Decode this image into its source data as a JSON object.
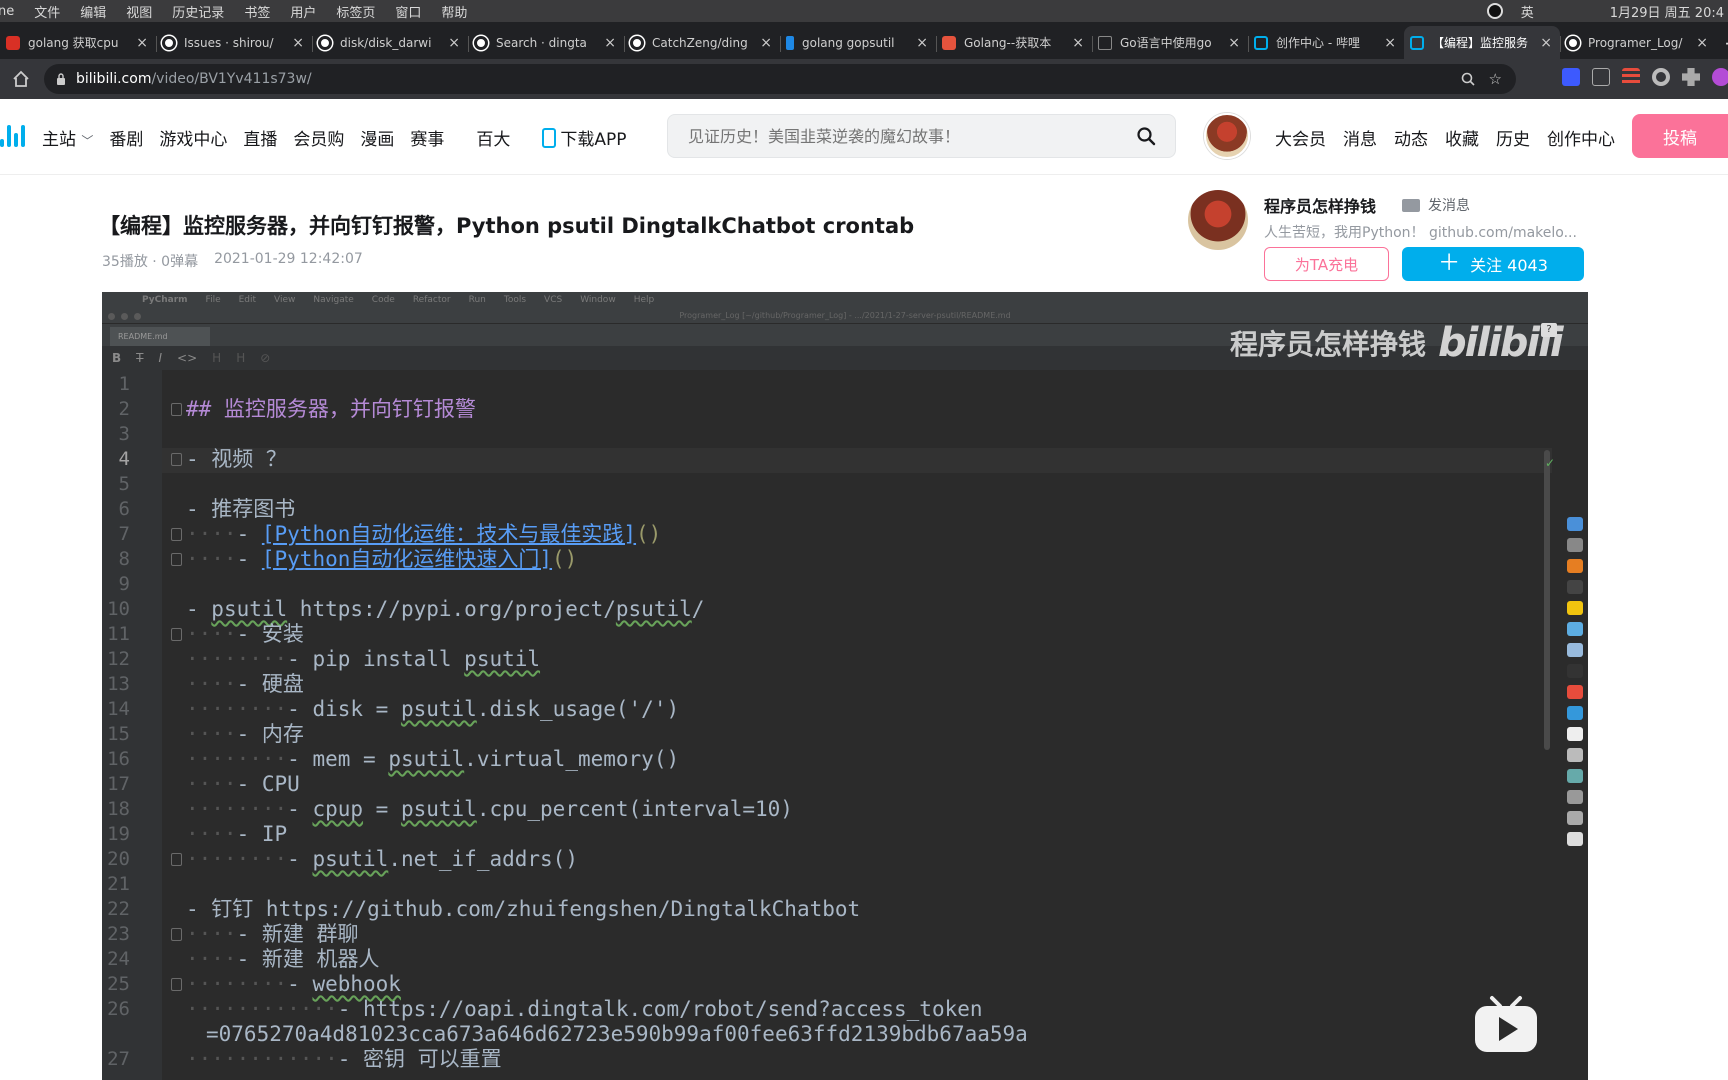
{
  "mac_menubar": {
    "items": [
      "ne",
      "文件",
      "编辑",
      "视图",
      "历史记录",
      "书签",
      "用户",
      "标签页",
      "窗口",
      "帮助"
    ],
    "input_method": "英",
    "datetime": "1月29日 周五  20:4"
  },
  "tabs": [
    {
      "label": "golang 获取cpu",
      "icon": "red-c-icon",
      "color": "#d93025"
    },
    {
      "label": "Issues · shirou/",
      "icon": "github-icon",
      "color": "#ffffff"
    },
    {
      "label": "disk/disk_darwi",
      "icon": "github-icon",
      "color": "#ffffff"
    },
    {
      "label": "Search · dingta",
      "icon": "github-icon",
      "color": "#ffffff"
    },
    {
      "label": "CatchZeng/ding",
      "icon": "github-icon",
      "color": "#ffffff"
    },
    {
      "label": "golang gopsutil",
      "icon": "bing-icon",
      "color": "#1e88e5"
    },
    {
      "label": "Golang--获取本",
      "icon": "jianshu-icon",
      "color": "#e5533d"
    },
    {
      "label": "Go语言中使用go",
      "icon": "doc-icon",
      "color": "#888888"
    },
    {
      "label": "创作中心 - 哔哩",
      "icon": "bilibili-tv-icon",
      "color": "#00aeec"
    },
    {
      "label": "【编程】监控服务",
      "icon": "bilibili-tv-icon",
      "color": "#00aeec",
      "active": true
    },
    {
      "label": "Programer_Log/",
      "icon": "github-icon",
      "color": "#ffffff"
    }
  ],
  "address": {
    "host": "bilibili.com",
    "path": "/video/BV1Yv411s73w/"
  },
  "bili_nav": {
    "items": [
      "主站",
      "番剧",
      "游戏中心",
      "直播",
      "会员购",
      "漫画",
      "赛事",
      "百大"
    ],
    "download": "下载APP",
    "search_placeholder": "见证历史！美国韭菜逆袭的魔幻故事！",
    "right_items": [
      "大会员",
      "消息",
      "动态",
      "收藏",
      "历史",
      "创作中心"
    ],
    "upload": "投稿"
  },
  "video": {
    "title": "【编程】监控服务器，并向钉钉报警，Python psutil DingtalkChatbot crontab",
    "stats": "35播放 · 0弹幕",
    "date": "2021-01-29 12:42:07"
  },
  "uploader": {
    "name": "程序员怎样挣钱",
    "message": "发消息",
    "desc": "人生苦短，我用Python！ github.com/makelo...",
    "charge": "为TA充电",
    "follow": "关注 4043"
  },
  "player": {
    "ide_menu": [
      "PyCharm",
      "File",
      "Edit",
      "View",
      "Navigate",
      "Code",
      "Refactor",
      "Run",
      "Tools",
      "VCS",
      "Window",
      "Help"
    ],
    "ide_title": "Programer_Log [~/github/Programer_Log] - .../2021/1-27-server-psutil/README.md",
    "ide_tab": "README.md",
    "watermark": "程序员怎样挣钱",
    "watermark_logo": "bilibili",
    "code_lines": [
      "",
      "## 监控服务器，并向钉钉报警",
      "",
      "- 视频 ？",
      "",
      "- 推荐图书",
      "    - [Python自动化运维：技术与最佳实践]()",
      "    - [Python自动化运维快速入门]()",
      "",
      "- psutil https://pypi.org/project/psutil/",
      "    - 安装",
      "        - pip install psutil",
      "    - 硬盘",
      "        - disk = psutil.disk_usage('/')",
      "    - 内存",
      "        - mem = psutil.virtual_memory()",
      "    - CPU",
      "        - cpup = psutil.cpu_percent(interval=10)",
      "    - IP",
      "        - psutil.net_if_addrs()",
      "",
      "- 钉钉 https://github.com/zhuifengshen/DingtalkChatbot",
      "    - 新建 群聊",
      "    - 新建 机器人",
      "        - webhook",
      "            - https://oapi.dingtalk.com/robot/send?access_token",
      "=0765270a4d81023cca673a646d62723e590b99af00fee63ffd2139bdb67aa59a",
      "            - 密钥 可以重置"
    ],
    "line_numbers": [
      "1",
      "2",
      "3",
      "4",
      "5",
      "6",
      "7",
      "8",
      "9",
      "10",
      "11",
      "12",
      "13",
      "14",
      "15",
      "16",
      "17",
      "18",
      "19",
      "20",
      "21",
      "22",
      "23",
      "24",
      "25",
      "26",
      "",
      "27"
    ]
  }
}
